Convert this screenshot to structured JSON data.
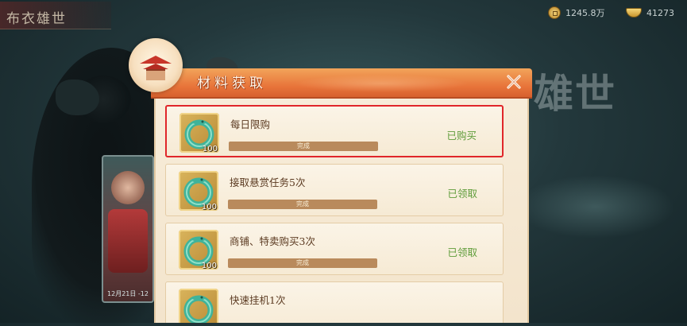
{
  "top_bar": {
    "title": "布衣雄世",
    "coins": "1245.8万",
    "ingots": "41273"
  },
  "background": {
    "logo_text": "雄世",
    "card_date": "12月21日 -12"
  },
  "modal": {
    "title": "材料获取"
  },
  "item": {
    "icon": "jade-dragon-ring-icon",
    "count": "100"
  },
  "tasks": [
    {
      "name": "每日限购",
      "progress_label": "完成",
      "progress": 1.0,
      "status": "已购买"
    },
    {
      "name": "接取悬赏任务5次",
      "progress_label": "完成",
      "progress": 1.0,
      "status": "已领取"
    },
    {
      "name": "商铺、特卖购买3次",
      "progress_label": "完成",
      "progress": 1.0,
      "status": "已领取"
    },
    {
      "name": "快速挂机1次"
    }
  ],
  "colors": {
    "header_orange": "#e8743a",
    "status_green": "#5f9c3a",
    "highlight_red": "#e0262a",
    "progress_fill": "#b98a5c"
  }
}
